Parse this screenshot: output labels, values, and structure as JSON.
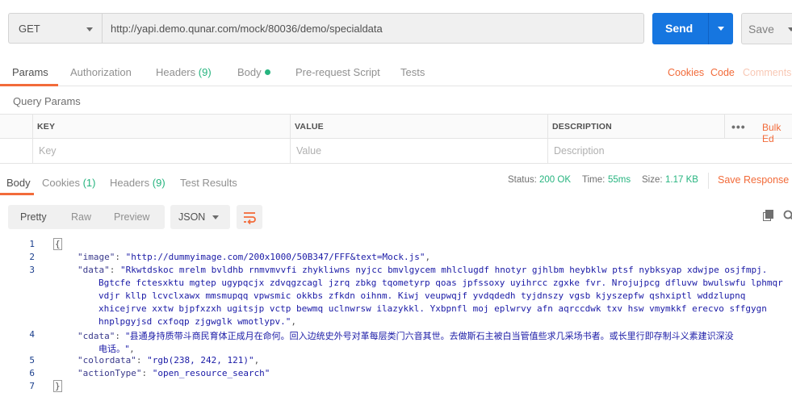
{
  "request": {
    "method": "GET",
    "url": "http://yapi.demo.qunar.com/mock/80036/demo/specialdata",
    "send_label": "Send",
    "save_label": "Save"
  },
  "request_tabs": {
    "params": "Params",
    "authorization": "Authorization",
    "headers": "Headers",
    "headers_count": "(9)",
    "body": "Body",
    "prerequest": "Pre-request Script",
    "tests": "Tests",
    "cookies": "Cookies",
    "code": "Code",
    "comments": "Comments"
  },
  "query_params": {
    "title": "Query Params",
    "columns": [
      "KEY",
      "VALUE",
      "DESCRIPTION"
    ],
    "bulk_edit": "Bulk Ed",
    "placeholders": {
      "key": "Key",
      "value": "Value",
      "description": "Description"
    }
  },
  "response_tabs": {
    "body": "Body",
    "cookies": "Cookies",
    "cookies_count": "(1)",
    "headers": "Headers",
    "headers_count": "(9)",
    "test_results": "Test Results",
    "status_label": "Status:",
    "status_value": "200 OK",
    "time_label": "Time:",
    "time_value": "55ms",
    "size_label": "Size:",
    "size_value": "1.17 KB",
    "save_response": "Save Response"
  },
  "toolbar": {
    "pretty": "Pretty",
    "raw": "Raw",
    "preview": "Preview",
    "format": "JSON"
  },
  "code": {
    "line_numbers": [
      "1",
      "2",
      "3",
      "4",
      "5",
      "6",
      "7"
    ],
    "open_brace": "{",
    "close_brace": "}",
    "image_key": "\"image\"",
    "image_val": "\"http://dummyimage.com/200x1000/50B347/FFF&text=Mock.js\"",
    "data_key": "\"data\"",
    "data_lines": [
      "\"Rkwtdskoc mrelm bvldhb rnmvmvvfi zhykliwns nyjcc bmvlgycem mhlclugdf hnotyr gjhlbm heybklw ptsf nybksyap xdwjpe osjfmpj.",
      "Bgtcfe fctesxktu mgtep ugypqcjx zdvqgzcagl jzrq zbkg tqometyrp qoas jpfssoxy uyihrcc zgxke fvr. Nrojujpcg dfluvw bwulswfu lphmqr",
      "vdjr kllp lcvclxawx mmsmupqq vpwsmic okkbs zfkdn oihnm. Kiwj veupwqjf yvdqdedh tyjdnszy vgsb kjyszepfw qshxiptl wddzlupnq",
      "xhicejrve xxtw bjpfxzxh ugitsjp vctp bewmq uclnwrsw ilazykkl. Yxbpnfl moj eplwrvy afn aqrccdwk txv hsw vmymkkf erecvo sffgygn",
      "hnplpgyjsd cxfoqp zjgwglk wmotlypv.\""
    ],
    "cdata_key": "\"cdata\"",
    "cdata_lines": [
      "\"县通身持质带斗商民育体正成月在命何。回入边统史外号对革每层类门六音其世。去做斯石主被白当管值些求几采场书者。或长里行即存制斗义素建识深没",
      "电话。\""
    ],
    "colordata_key": "\"colordata\"",
    "colordata_val": "\"rgb(238, 242, 121)\"",
    "actiontype_key": "\"actionType\"",
    "actiontype_val": "\"open_resource_search\""
  },
  "colors": {
    "accent_orange": "#f26b3a",
    "send_blue": "#1676e0",
    "status_green": "#26b47f"
  }
}
